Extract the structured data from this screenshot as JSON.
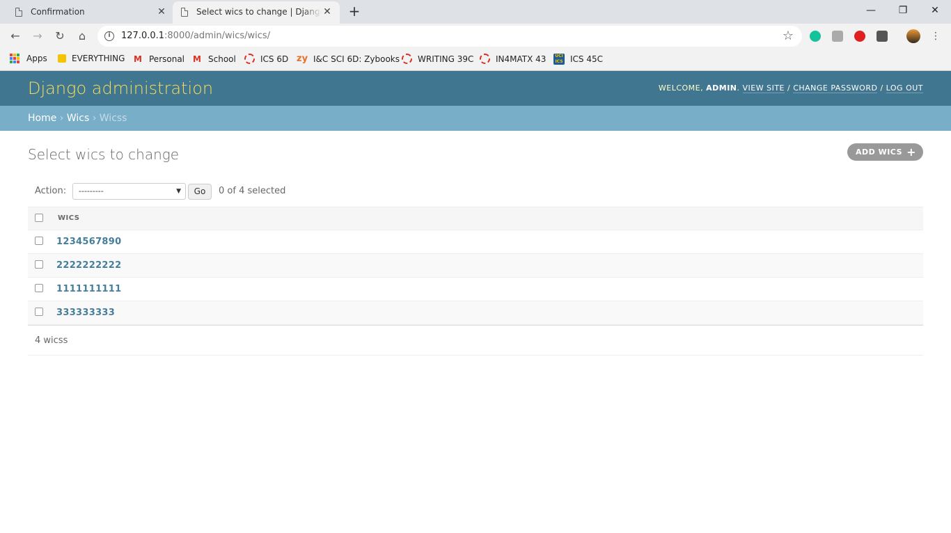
{
  "browser": {
    "tabs": [
      {
        "title": "Confirmation",
        "active": false
      },
      {
        "title": "Select wics to change | Django site admin",
        "active": true
      }
    ],
    "window_controls": {
      "minimize": "—",
      "maximize": "❐",
      "close": "✕"
    },
    "url_host": "127.0.0.1",
    "url_rest": ":8000/admin/wics/wics/",
    "bookmarks": [
      {
        "label": "Apps",
        "icon": "apps-grid-icon"
      },
      {
        "label": "EVERYTHING",
        "icon": "folder-icon"
      },
      {
        "label": "Personal",
        "icon": "gmail-icon"
      },
      {
        "label": "School",
        "icon": "gmail-icon"
      },
      {
        "label": "ICS 6D",
        "icon": "canvas-icon"
      },
      {
        "label": "I&C SCI 6D: Zybooks",
        "icon": "zybooks-icon"
      },
      {
        "label": "WRITING 39C",
        "icon": "canvas-icon"
      },
      {
        "label": "IN4MATX 43",
        "icon": "canvas-icon"
      },
      {
        "label": "ICS 45C",
        "icon": "uci-icon"
      }
    ]
  },
  "admin": {
    "branding": "Django administration",
    "usertools": {
      "welcome": "WELCOME, ",
      "username": "ADMIN",
      "view_site": "VIEW SITE",
      "change_password": "CHANGE PASSWORD",
      "log_out": "LOG OUT"
    },
    "breadcrumbs": {
      "home": "Home",
      "app": "Wics",
      "current": "Wicss"
    },
    "title": "Select wics to change",
    "add_button": "ADD WICS",
    "actions": {
      "label": "Action:",
      "selected_option": "---------",
      "go": "Go",
      "counter": "0 of 4 selected"
    },
    "table": {
      "column": "WICS",
      "rows": [
        "1234567890",
        "2222222222",
        "1111111111",
        "333333333"
      ]
    },
    "paginator": "4 wicss"
  }
}
